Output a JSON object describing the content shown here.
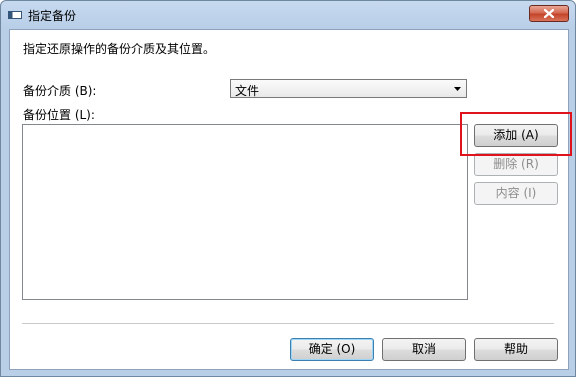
{
  "window": {
    "title": "指定备份",
    "icon": "window-icon",
    "close_icon": "close-icon"
  },
  "dialog": {
    "instruction": "指定还原操作的备份介质及其位置。",
    "media_label": "备份介质 (B):",
    "media_value": "文件",
    "location_label": "备份位置 (L):",
    "locations": []
  },
  "side_buttons": {
    "add": "添加 (A)",
    "delete": "删除 (R)",
    "properties": "内容 (I)"
  },
  "footer_buttons": {
    "ok": "确定 (O)",
    "cancel": "取消",
    "help": "帮助"
  },
  "colors": {
    "highlight": "#e0121b",
    "title_bar": "#c6d9ef",
    "close_button": "#c4442a"
  }
}
